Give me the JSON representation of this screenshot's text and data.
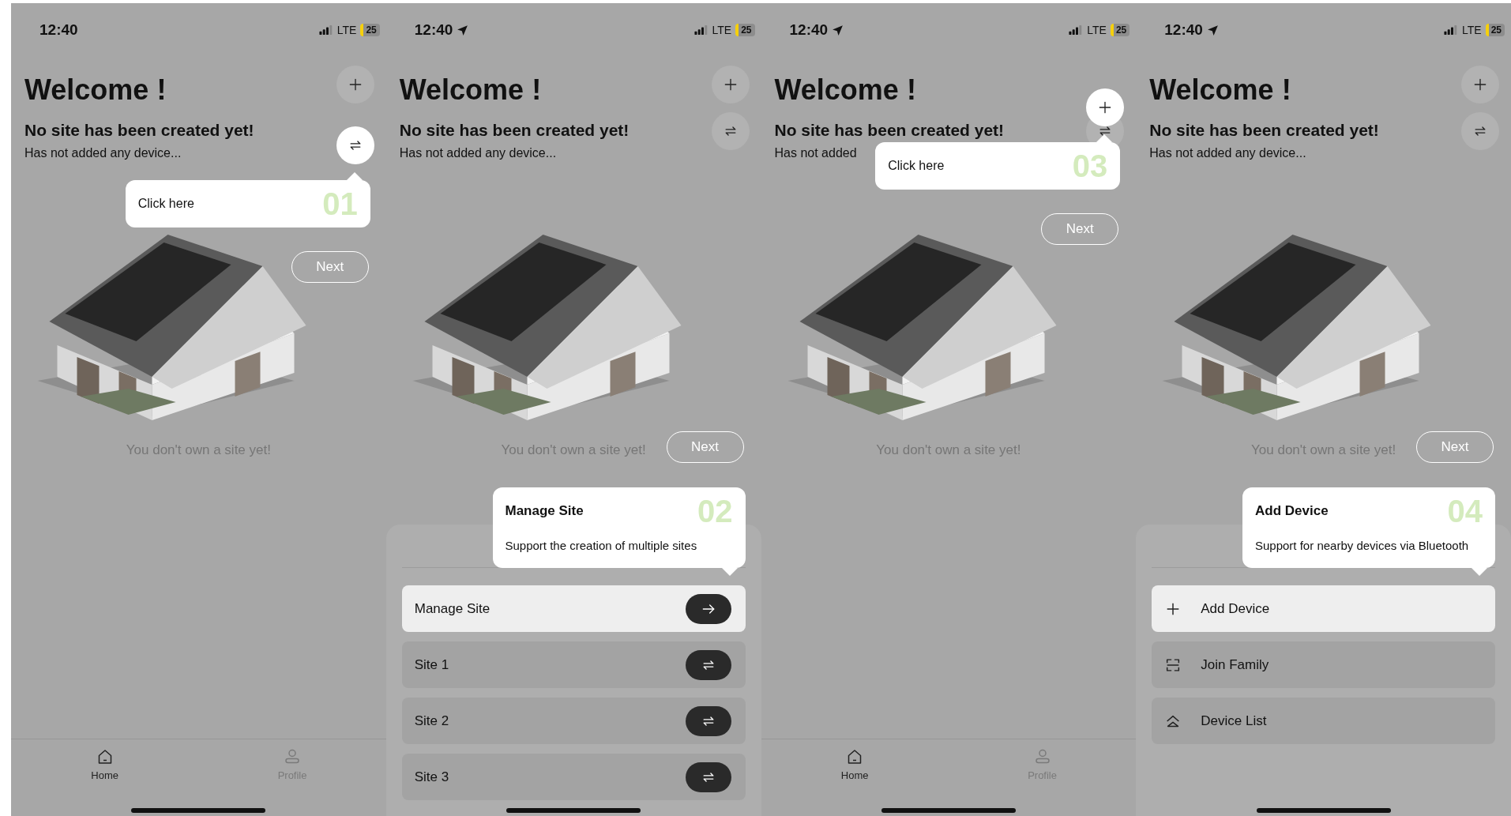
{
  "screens": [
    {
      "status_bar": {
        "time": "12:40",
        "location": false,
        "network": "LTE",
        "battery": "25"
      },
      "title": "Welcome !",
      "subtitle": "No site has been created yet!",
      "description": "Has not added any device...",
      "header_buttons": [
        {
          "kind": "add"
        },
        {
          "kind": "switch"
        }
      ],
      "empty_message": "You don't own a site yet!",
      "tour": {
        "kind": "switch",
        "step": "01",
        "text": "Click here",
        "next": "Next"
      },
      "bottom": {
        "kind": "tab_bar",
        "tabs": [
          {
            "label": "Home",
            "kind": "home",
            "selected": true
          },
          {
            "label": "Profile",
            "kind": "profile",
            "selected": false
          }
        ]
      }
    },
    {
      "status_bar": {
        "time": "12:40",
        "location": true,
        "network": "LTE",
        "battery": "25"
      },
      "title": "Welcome !",
      "subtitle": "No site has been created yet!",
      "description": "Has not added any device...",
      "header_buttons": [
        {
          "kind": "add"
        },
        {
          "kind": "switch"
        }
      ],
      "empty_message": "You don't own a site yet!",
      "tour": {
        "kind": "sheet",
        "step": "02",
        "title": "Manage Site",
        "text": "Support the creation of multiple sites",
        "next": "Next"
      },
      "bottom": {
        "kind": "sheet",
        "items": [
          {
            "label": "Manage Site",
            "kind": "open",
            "highlighted": true
          },
          {
            "label": "Site 1",
            "kind": "switch",
            "highlighted": false
          },
          {
            "label": "Site 2",
            "kind": "switch",
            "highlighted": false
          },
          {
            "label": "Site 3",
            "kind": "switch",
            "highlighted": false
          }
        ]
      }
    },
    {
      "status_bar": {
        "time": "12:40",
        "location": true,
        "network": "LTE",
        "battery": "25"
      },
      "title": "Welcome !",
      "subtitle": "No site has been created yet!",
      "description": "Has not added",
      "header_buttons": [
        {
          "kind": "add"
        },
        {
          "kind": "switch"
        }
      ],
      "empty_message": "You don't own a site yet!",
      "tour": {
        "kind": "add",
        "step": "03",
        "text": "Click here",
        "next": "Next"
      },
      "bottom": {
        "kind": "tab_bar",
        "tabs": [
          {
            "label": "Home",
            "kind": "home",
            "selected": true
          },
          {
            "label": "Profile",
            "kind": "profile",
            "selected": false
          }
        ]
      }
    },
    {
      "status_bar": {
        "time": "12:40",
        "location": true,
        "network": "LTE",
        "battery": "25"
      },
      "title": "Welcome !",
      "subtitle": "No site has been created yet!",
      "description": "Has not added any device...",
      "header_buttons": [
        {
          "kind": "add"
        },
        {
          "kind": "switch"
        }
      ],
      "empty_message": "You don't own a site yet!",
      "tour": {
        "kind": "sheet",
        "step": "04",
        "title": "Add Device",
        "text": "Support for nearby devices via Bluetooth",
        "next": "Next"
      },
      "bottom": {
        "kind": "sheet",
        "items": [
          {
            "label": "Add Device",
            "kind": "add",
            "highlighted": true
          },
          {
            "label": "Join Family",
            "kind": "join",
            "highlighted": false
          },
          {
            "label": "Device List",
            "kind": "list",
            "highlighted": false
          }
        ]
      }
    }
  ]
}
